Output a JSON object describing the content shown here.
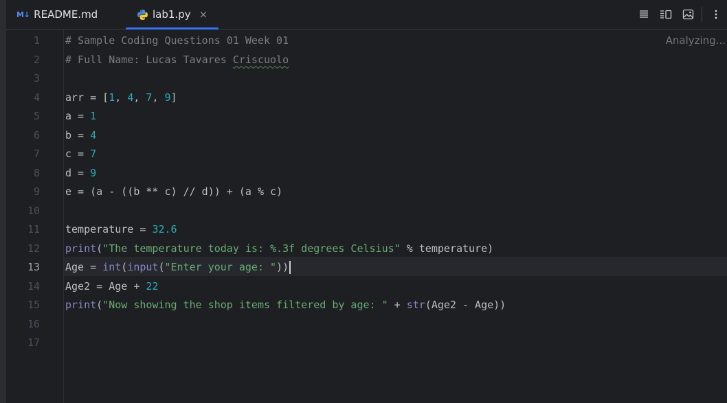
{
  "tabs": [
    {
      "icon": "markdown-icon",
      "icon_text": "M↓",
      "label": "README.md",
      "active": false
    },
    {
      "icon": "python-icon",
      "label": "lab1.py",
      "active": true,
      "close": "×"
    }
  ],
  "status": {
    "analyzing": "Analyzing..."
  },
  "editor": {
    "current_line": 13,
    "line_numbers": [
      "1",
      "2",
      "3",
      "4",
      "5",
      "6",
      "7",
      "8",
      "9",
      "10",
      "11",
      "12",
      "13",
      "14",
      "15",
      "16",
      "17"
    ],
    "lines": [
      "# Sample Coding Questions 01 Week 01",
      "# Full Name: Lucas Tavares Criscuolo",
      "",
      "arr = [1, 4, 7, 9]",
      "a = 1",
      "b = 4",
      "c = 7",
      "d = 9",
      "e = (a - ((b ** c) // d)) + (a % c)",
      "",
      "temperature = 32.6",
      "print(\"The temperature today is: %.3f degrees Celsius\" % temperature)",
      "Age = int(input(\"Enter your age: \"))",
      "Age2 = Age + 22",
      "print(\"Now showing the shop items filtered by age: \" + str(Age2 - Age))",
      "",
      ""
    ]
  },
  "colors": {
    "accent": "#3574f0",
    "comment": "#7a7e85",
    "number": "#2aacb8",
    "string": "#6aab73",
    "builtin": "#8888c6"
  }
}
